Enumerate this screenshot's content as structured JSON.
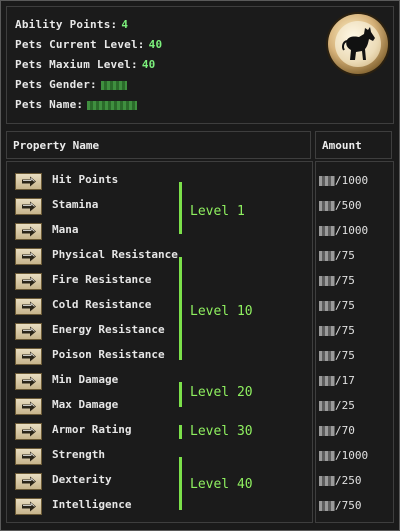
{
  "info": {
    "ability_points_label": "Ability Points:",
    "ability_points": "4",
    "current_level_label": "Pets Current Level:",
    "current_level": "40",
    "max_level_label": "Pets Maxium Level:",
    "max_level": "40",
    "gender_label": "Pets Gender:",
    "name_label": "Pets Name:"
  },
  "emblem_icon": "horse-icon",
  "table": {
    "col_property": "Property Name",
    "col_amount": "Amount",
    "rows": [
      {
        "name": "Hit Points",
        "max": "/1000"
      },
      {
        "name": "Stamina",
        "max": "/500"
      },
      {
        "name": "Mana",
        "max": "/1000"
      },
      {
        "name": "Physical Resistance",
        "max": "/75"
      },
      {
        "name": "Fire Resistance",
        "max": "/75"
      },
      {
        "name": "Cold Resistance",
        "max": "/75"
      },
      {
        "name": "Energy Resistance",
        "max": "/75"
      },
      {
        "name": "Poison Resistance",
        "max": "/75"
      },
      {
        "name": "Min Damage",
        "max": "/17"
      },
      {
        "name": "Max Damage",
        "max": "/25"
      },
      {
        "name": "Armor Rating",
        "max": "/70"
      },
      {
        "name": "Strength",
        "max": "/1000"
      },
      {
        "name": "Dexterity",
        "max": "/250"
      },
      {
        "name": "Intelligence",
        "max": "/750"
      }
    ],
    "level_groups": [
      {
        "label": "Level 1"
      },
      {
        "label": "Level 10"
      },
      {
        "label": "Level 20"
      },
      {
        "label": "Level 30"
      },
      {
        "label": "Level 40"
      }
    ]
  },
  "colors": {
    "accent_green": "#7ce04a",
    "value_green": "#7cf07c",
    "text": "#e6e6e6"
  }
}
